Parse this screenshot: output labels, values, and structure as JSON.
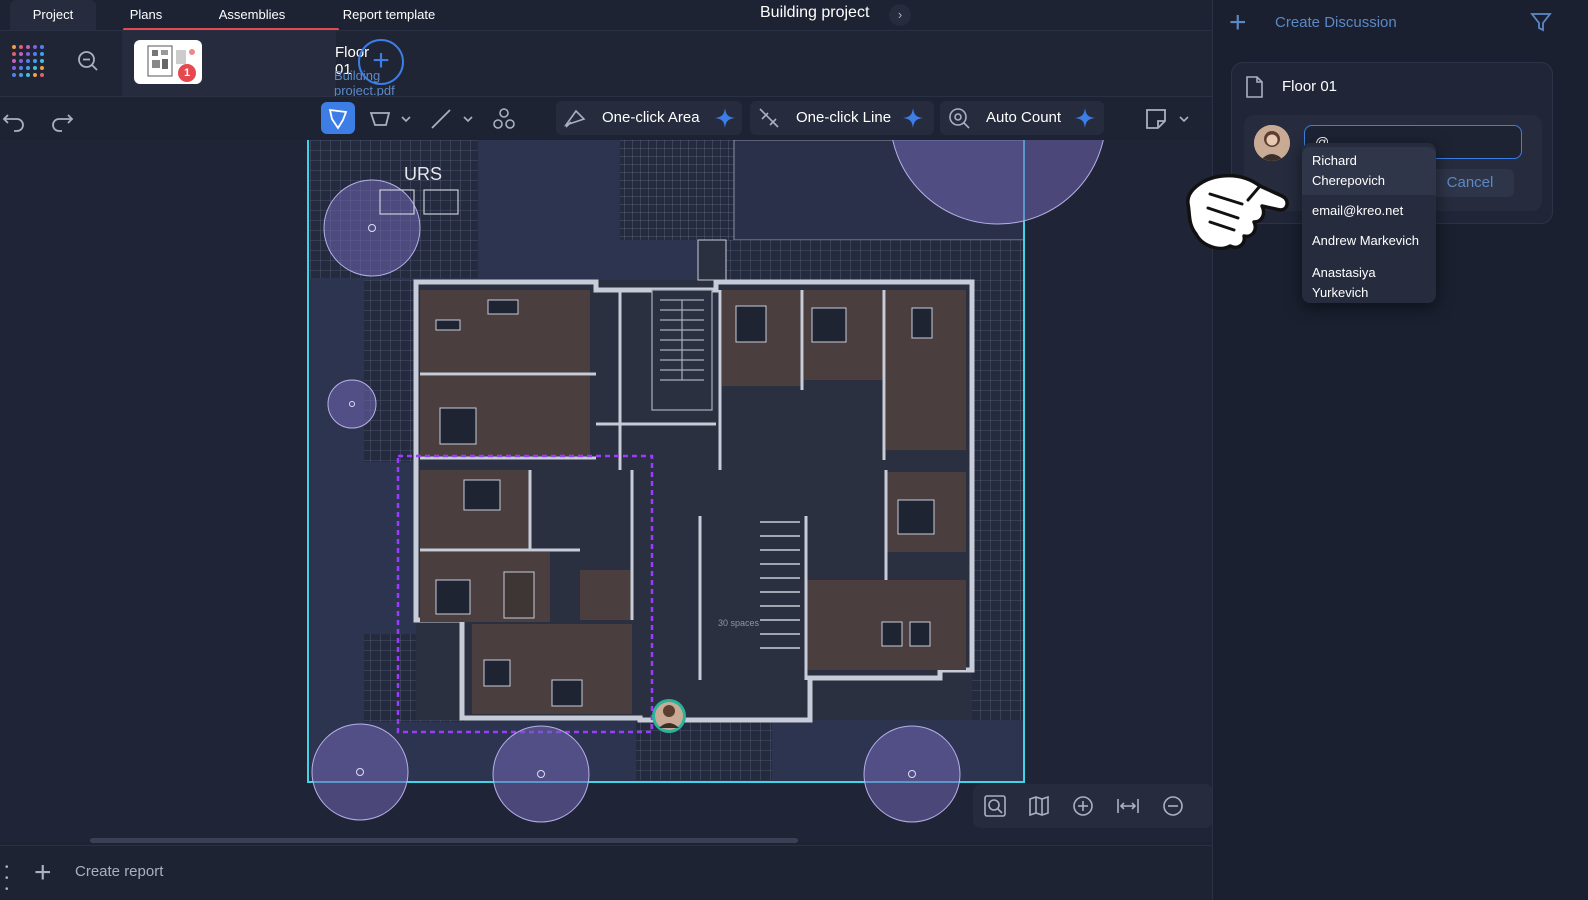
{
  "tabs": {
    "project": "Project",
    "plans": "Plans",
    "assemblies": "Assemblies",
    "report_template": "Report template"
  },
  "project_title": "Building project",
  "plan": {
    "name": "Floor 01",
    "file": "Building project.pdf",
    "badge_count": "1"
  },
  "toolbar": {
    "one_click_area": "One-click Area",
    "one_click_line": "One-click Line",
    "auto_count": "Auto Count"
  },
  "drawing_labels": {
    "urs": "URS",
    "spaces": "30 spaces"
  },
  "bottom": {
    "create_report": "Create report"
  },
  "right_panel": {
    "create_discussion": "Create Discussion",
    "floor_title": "Floor 01",
    "input_value": "@",
    "cancel": "Cancel",
    "mentions": [
      {
        "name": "Richard Cherepovich"
      },
      {
        "name": "email@kreo.net"
      },
      {
        "name": "Andrew Markevich"
      },
      {
        "name": "Anastasiya Yurkevich"
      }
    ]
  },
  "colors": {
    "accent": "#3d7ee6",
    "plans_underline": "#e5484d",
    "selection_dashed": "#9b3bff",
    "boundary": "#3fd4e6"
  },
  "icons": {
    "undo": "undo-icon",
    "redo": "redo-icon",
    "filter": "filter-icon",
    "document": "document-icon"
  }
}
